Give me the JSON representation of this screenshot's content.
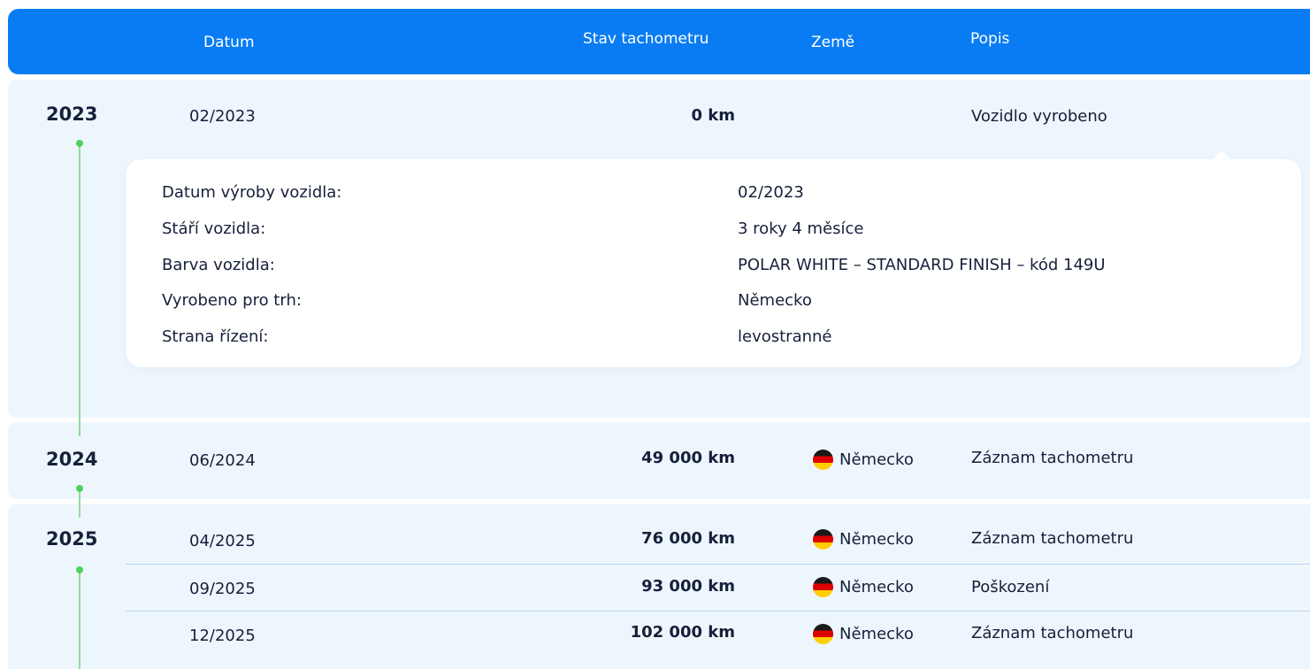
{
  "header": {
    "date_label": "Datum",
    "odometer_label": "Stav tachometru",
    "country_label": "Země",
    "description_label": "Popis"
  },
  "groups": [
    {
      "year": "2023",
      "entries": [
        {
          "date": "02/2023",
          "odometer": "0 km",
          "country": "",
          "description": "Vozidlo vyrobeno"
        }
      ],
      "details": [
        {
          "label": "Datum výroby vozidla:",
          "value": "02/2023"
        },
        {
          "label": "Stáří vozidla:",
          "value": "3 roky 4 měsíce"
        },
        {
          "label": "Barva vozidla:",
          "value": "POLAR WHITE – STANDARD FINISH – kód 149U"
        },
        {
          "label": "Vyrobeno pro trh:",
          "value": "Německo"
        },
        {
          "label": "Strana řízení:",
          "value": "levostranné"
        }
      ]
    },
    {
      "year": "2024",
      "entries": [
        {
          "date": "06/2024",
          "odometer": "49 000 km",
          "country": "Německo",
          "description": "Záznam tachometru"
        }
      ]
    },
    {
      "year": "2025",
      "entries": [
        {
          "date": "04/2025",
          "odometer": "76 000 km",
          "country": "Německo",
          "description": "Záznam tachometru"
        },
        {
          "date": "09/2025",
          "odometer": "93 000 km",
          "country": "Německo",
          "description": "Poškození"
        },
        {
          "date": "12/2025",
          "odometer": "102 000 km",
          "country": "Německo",
          "description": "Záznam tachometru"
        }
      ]
    }
  ],
  "colors": {
    "header_bg": "#0a7cf3",
    "section_bg": "#eef6fd",
    "timeline_dot": "#4fd15c",
    "timeline_line": "#8fdc97"
  },
  "icons": {
    "flag": "germany-flag-icon"
  }
}
